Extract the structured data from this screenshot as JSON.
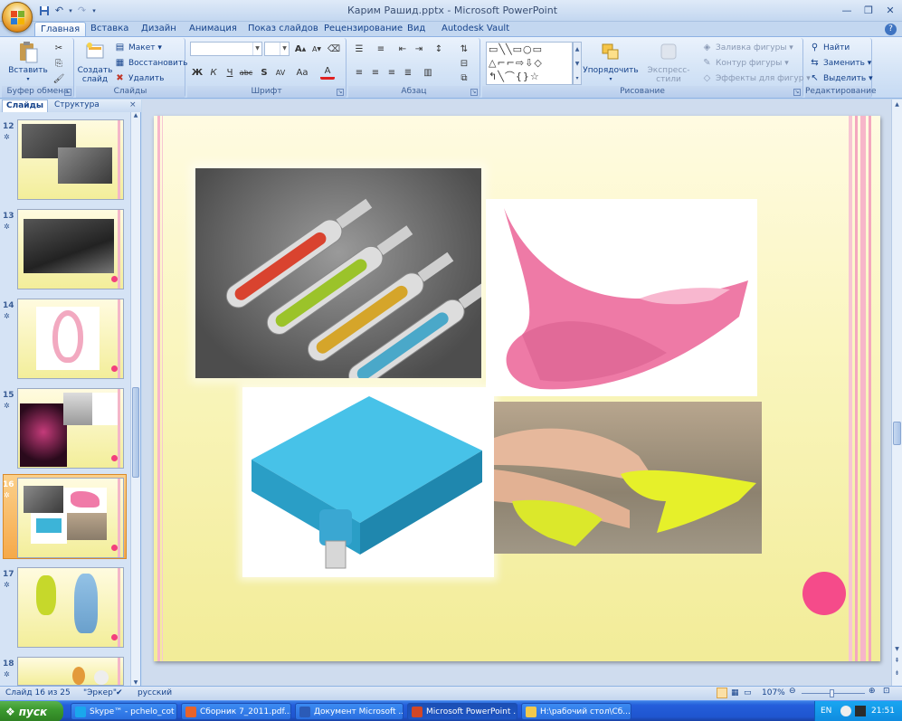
{
  "window": {
    "title": "Карим Рашид.pptx - Microsoft PowerPoint",
    "minimize": "—",
    "maximize": "❐",
    "close": "✕"
  },
  "qat": {
    "save_icon": "save-icon",
    "undo_icon": "undo-icon",
    "redo_icon": "redo-icon",
    "customize_icon": "chevron-down-icon"
  },
  "tabs": [
    "Главная",
    "Вставка",
    "Дизайн",
    "Анимация",
    "Показ слайдов",
    "Рецензирование",
    "Вид",
    "Autodesk Vault"
  ],
  "active_tab": "Главная",
  "ribbon": {
    "clipboard": {
      "label": "Буфер обмена",
      "paste": "Вставить"
    },
    "slides": {
      "label": "Слайды",
      "new_slide_line1": "Создать",
      "new_slide_line2": "слайд",
      "layout": "Макет",
      "reset": "Восстановить",
      "delete": "Удалить"
    },
    "font": {
      "label": "Шрифт",
      "bold": "Ж",
      "italic": "К",
      "underline": "Ч",
      "strike": "abc",
      "shadow": "S",
      "spacing": "AV",
      "case": "Aa",
      "color": "A",
      "grow": "A",
      "shrink": "A"
    },
    "paragraph": {
      "label": "Абзац"
    },
    "drawing": {
      "label": "Рисование",
      "arrange": "Упорядочить",
      "quick_styles": "Экспресс-стили",
      "fill": "Заливка фигуры",
      "outline": "Контур фигуры",
      "effects": "Эффекты для фигур"
    },
    "editing": {
      "label": "Редактирование",
      "find": "Найти",
      "replace": "Заменить",
      "select": "Выделить"
    }
  },
  "pane": {
    "tabs": [
      "Слайды",
      "Структура"
    ],
    "close": "×",
    "slides": [
      {
        "num": "12"
      },
      {
        "num": "13"
      },
      {
        "num": "14"
      },
      {
        "num": "15"
      },
      {
        "num": "16"
      },
      {
        "num": "17"
      },
      {
        "num": "18"
      }
    ],
    "selected": "16"
  },
  "status": {
    "slide": "Слайд 16 из 25",
    "theme": "\"Эркер\"",
    "language": "русский",
    "zoom": "107%"
  },
  "taskbar": {
    "start": "пуск",
    "tasks": [
      {
        "label": "Skype™ - pchelo_cot",
        "color": "#1aa7ec"
      },
      {
        "label": "Сборник 7_2011.pdf...",
        "color": "#e8632a"
      },
      {
        "label": "Документ Microsoft ...",
        "color": "#2b5bb7"
      },
      {
        "label": "Microsoft PowerPoint ...",
        "color": "#d24726"
      },
      {
        "label": "H:\\рабочий стол\\Сб...",
        "color": "#f2c94c"
      }
    ],
    "lang": "EN",
    "time": "21:51"
  },
  "colors": {
    "slide_accent": "#f54b8a",
    "selection": "#f6a94a"
  }
}
